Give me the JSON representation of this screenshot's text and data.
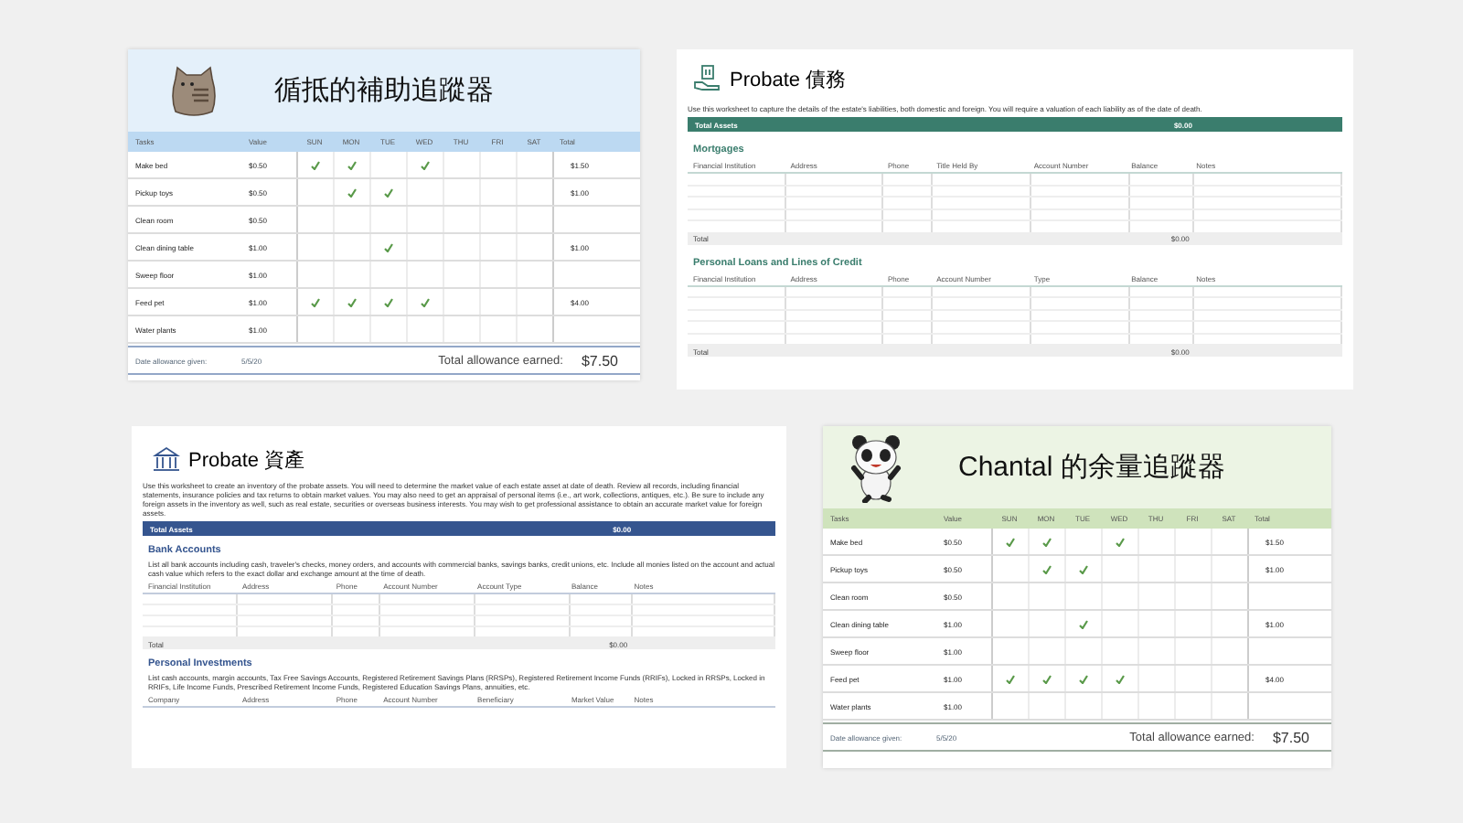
{
  "cards": [
    {
      "kind": "tracker",
      "color": "#bcd9f2",
      "title": "循抵的補助追蹤器",
      "columns": [
        "Tasks",
        "Value",
        "SUN",
        "MON",
        "TUE",
        "WED",
        "THU",
        "FRI",
        "SAT",
        "Total"
      ],
      "rows": [
        {
          "task": "Make bed",
          "value": "$0.50",
          "days": [
            true,
            true,
            false,
            true,
            false,
            false,
            false
          ],
          "total": "$1.50"
        },
        {
          "task": "Pickup toys",
          "value": "$0.50",
          "days": [
            false,
            true,
            true,
            false,
            false,
            false,
            false
          ],
          "total": "$1.00"
        },
        {
          "task": "Clean room",
          "value": "$0.50",
          "days": [
            false,
            false,
            false,
            false,
            false,
            false,
            false
          ],
          "total": ""
        },
        {
          "task": "Clean dining table",
          "value": "$1.00",
          "days": [
            false,
            false,
            true,
            false,
            false,
            false,
            false
          ],
          "total": "$1.00"
        },
        {
          "task": "Sweep floor",
          "value": "$1.00",
          "days": [
            false,
            false,
            false,
            false,
            false,
            false,
            false
          ],
          "total": ""
        },
        {
          "task": "Feed pet",
          "value": "$1.00",
          "days": [
            true,
            true,
            true,
            true,
            false,
            false,
            false
          ],
          "total": "$4.00"
        },
        {
          "task": "Water plants",
          "value": "$1.00",
          "days": [
            false,
            false,
            false,
            false,
            false,
            false,
            false
          ],
          "total": ""
        }
      ],
      "footer": {
        "date_label": "Date allowance given:",
        "date": "5/5/20",
        "total_label": "Total allowance earned:",
        "total": "$7.50"
      }
    },
    {
      "kind": "probate",
      "color": "#3a7d6d",
      "title": "Probate 債務",
      "description": "Use this worksheet to capture the details of the estate's liabilities, both domestic and foreign. You will require a valuation of each liability as of the date of death.",
      "summary": {
        "label": "Total Assets",
        "value": "$0.00"
      },
      "sections": [
        {
          "heading": "Mortgages",
          "columns": [
            "Financial Institution",
            "Address",
            "Phone",
            "Title Held By",
            "Account Number",
            "Balance",
            "Notes"
          ],
          "total": {
            "label": "Total",
            "value": "$0.00"
          }
        },
        {
          "heading": "Personal Loans and Lines of Credit",
          "columns": [
            "Financial Institution",
            "Address",
            "Phone",
            "Account Number",
            "Type",
            "Balance",
            "Notes"
          ],
          "total": {
            "label": "Total",
            "value": "$0.00"
          }
        }
      ]
    },
    {
      "kind": "probate",
      "color": "#35558f",
      "title": "Probate 資產",
      "description": "Use this worksheet to create an inventory of the probate assets. You will need to determine the market value of each estate asset at date of death. Review all records, including financial statements, insurance policies and tax returns to obtain market values. You may also need to get an appraisal of personal items (i.e., art work, collections, antiques, etc.). Be sure to include any foreign assets in the inventory as well, such as real estate, securities or overseas business interests. You may wish to get professional assistance to obtain an accurate market value for foreign assets.",
      "summary": {
        "label": "Total Assets",
        "value": "$0.00"
      },
      "sections": [
        {
          "heading": "Bank Accounts",
          "description": "List all bank accounts including cash, traveler's checks, money orders, and accounts with commercial banks, savings banks, credit unions, etc. Include all monies listed on the account and actual cash value which refers to the exact dollar and exchange amount at the time of death.",
          "columns": [
            "Financial Institution",
            "Address",
            "Phone",
            "Account Number",
            "Account Type",
            "Balance",
            "Notes"
          ],
          "total": {
            "label": "Total",
            "value": "$0.00"
          }
        },
        {
          "heading": "Personal Investments",
          "description": "List cash accounts, margin accounts, Tax Free Savings Accounts, Registered Retirement Savings Plans (RRSPs), Registered Retirement Income Funds (RRIFs), Locked in RRSPs, Locked in RRIFs, Life Income Funds, Prescribed Retirement Income Funds, Registered Education Savings Plans, annuities, etc.",
          "columns": [
            "Company",
            "Address",
            "Phone",
            "Account Number",
            "Beneficiary",
            "Market Value",
            "Notes"
          ]
        }
      ]
    },
    {
      "kind": "tracker",
      "color": "#cfe3bc",
      "title": "Chantal 的余量追蹤器",
      "columns": [
        "Tasks",
        "Value",
        "SUN",
        "MON",
        "TUE",
        "WED",
        "THU",
        "FRI",
        "SAT",
        "Total"
      ],
      "rows": [
        {
          "task": "Make bed",
          "value": "$0.50",
          "days": [
            true,
            true,
            false,
            true,
            false,
            false,
            false
          ],
          "total": "$1.50"
        },
        {
          "task": "Pickup toys",
          "value": "$0.50",
          "days": [
            false,
            true,
            true,
            false,
            false,
            false,
            false
          ],
          "total": "$1.00"
        },
        {
          "task": "Clean room",
          "value": "$0.50",
          "days": [
            false,
            false,
            false,
            false,
            false,
            false,
            false
          ],
          "total": ""
        },
        {
          "task": "Clean dining table",
          "value": "$1.00",
          "days": [
            false,
            false,
            true,
            false,
            false,
            false,
            false
          ],
          "total": "$1.00"
        },
        {
          "task": "Sweep floor",
          "value": "$1.00",
          "days": [
            false,
            false,
            false,
            false,
            false,
            false,
            false
          ],
          "total": ""
        },
        {
          "task": "Feed pet",
          "value": "$1.00",
          "days": [
            true,
            true,
            true,
            true,
            false,
            false,
            false
          ],
          "total": "$4.00"
        },
        {
          "task": "Water plants",
          "value": "$1.00",
          "days": [
            false,
            false,
            false,
            false,
            false,
            false,
            false
          ],
          "total": ""
        }
      ],
      "footer": {
        "date_label": "Date allowance given:",
        "date": "5/5/20",
        "total_label": "Total allowance earned:",
        "total": "$7.50"
      }
    }
  ]
}
